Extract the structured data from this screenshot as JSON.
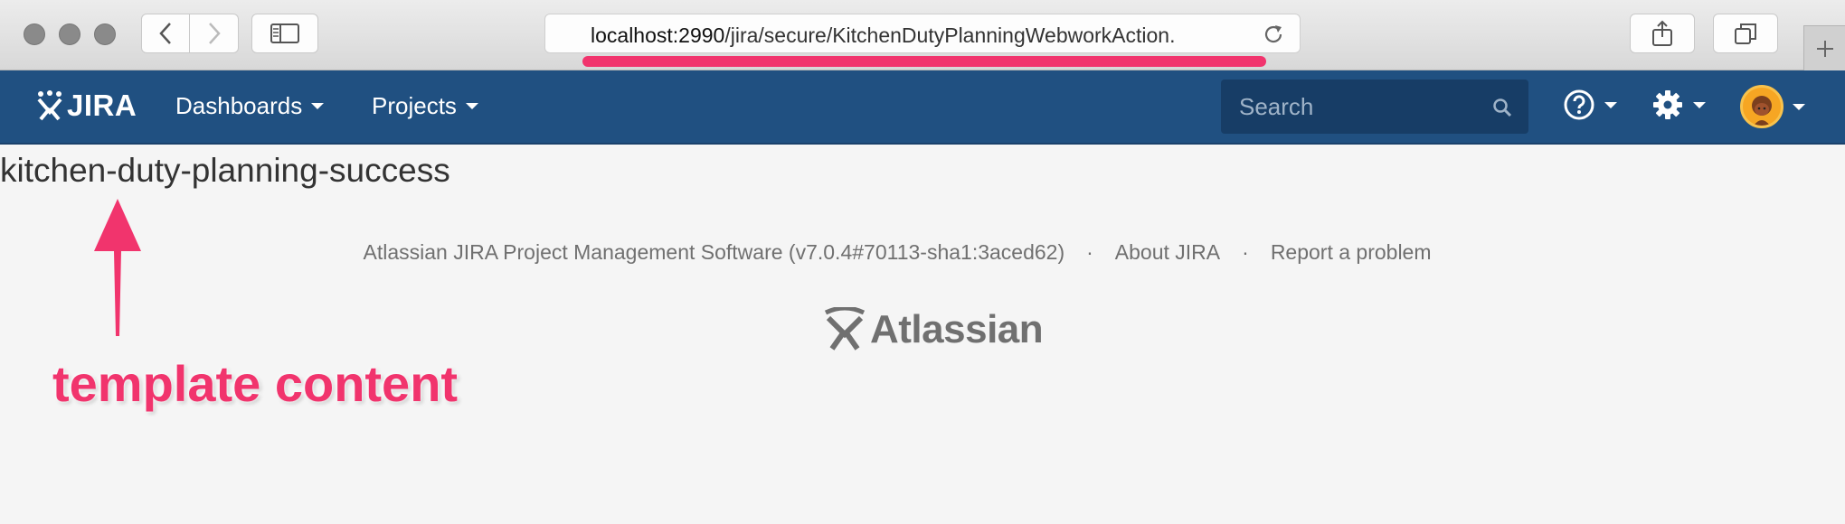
{
  "browser": {
    "url_host": "localhost:2990",
    "url_path": "/jira/secure/KitchenDutyPlanningWebworkAction."
  },
  "header": {
    "logo_text": "JIRA",
    "nav": [
      {
        "label": "Dashboards"
      },
      {
        "label": "Projects"
      }
    ],
    "search": {
      "placeholder": "Search"
    }
  },
  "main": {
    "title": "kitchen-duty-planning-success"
  },
  "footer": {
    "software": "Atlassian JIRA Project Management Software (v7.0.4#70113-sha1:3aced62)",
    "separator": "·",
    "about_link": "About JIRA",
    "report_link": "Report a problem",
    "logo_text": "Atlassian"
  },
  "annotation": {
    "label": "template content",
    "color": "#f1346d"
  },
  "colors": {
    "header_bg": "#205081",
    "accent": "#f1346d",
    "avatar": "#f6a623"
  }
}
